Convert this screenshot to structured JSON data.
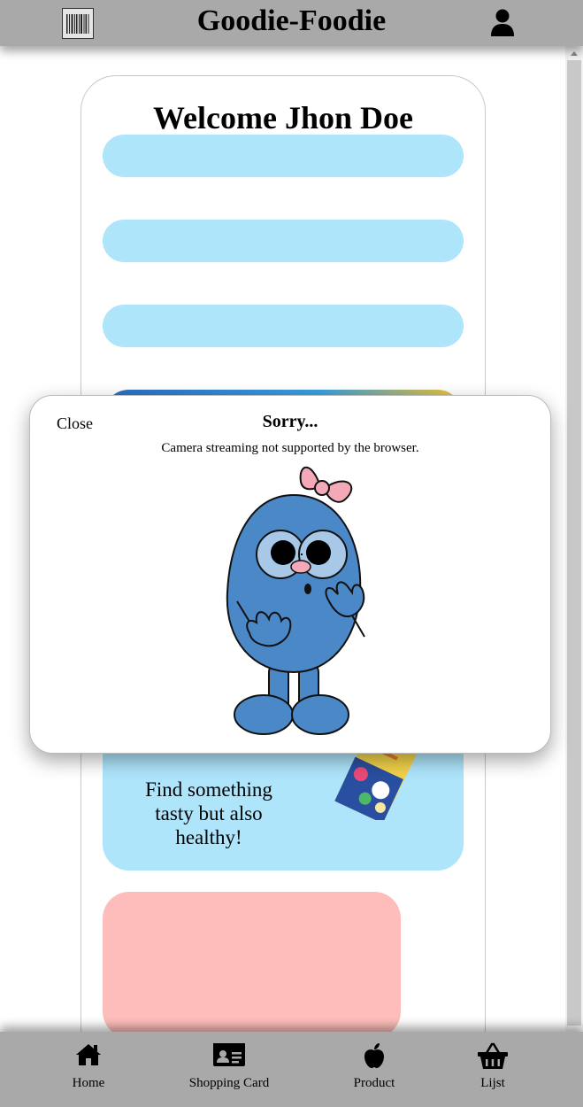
{
  "header": {
    "title": "Goodie-Foodie",
    "scan_icon": "barcode-icon",
    "user_icon": "user-icon"
  },
  "main": {
    "welcome": "Welcome Jhon Doe",
    "promo": {
      "text": "Find something tasty but also healthy!"
    }
  },
  "modal": {
    "close_label": "Close",
    "title": "Sorry...",
    "message": "Camera streaming not supported by the browser.",
    "illustration": "mascot-illustration"
  },
  "bottom_nav": {
    "items": [
      {
        "label": "Home",
        "icon": "home-icon"
      },
      {
        "label": "Shopping Card",
        "icon": "id-card-icon"
      },
      {
        "label": "Product",
        "icon": "apple-icon"
      },
      {
        "label": "Lijst",
        "icon": "basket-icon"
      }
    ]
  },
  "colors": {
    "header_bg": "#a9a9a9",
    "pill_blue": "#aee5fb",
    "card_pink": "#fdbebb",
    "mascot_blue": "#4a88c8"
  }
}
